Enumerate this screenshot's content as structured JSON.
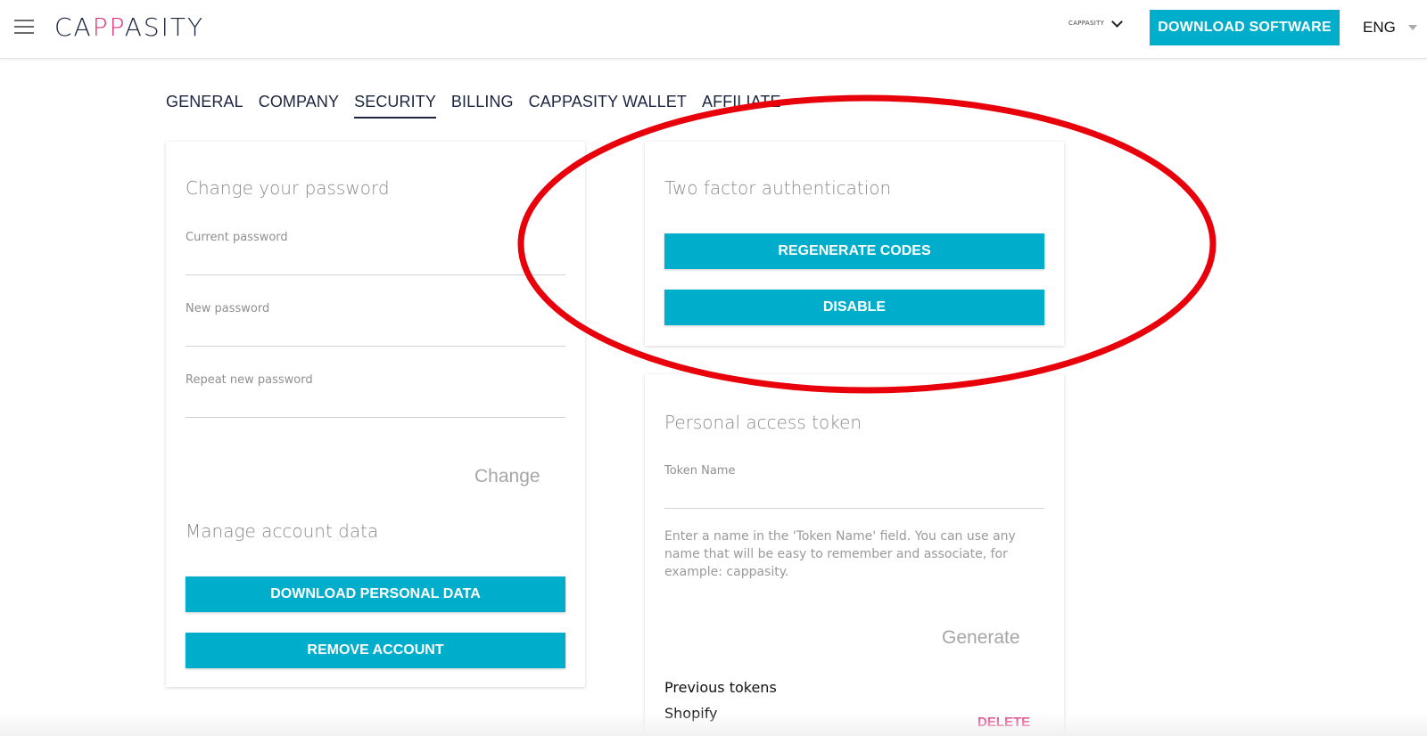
{
  "header": {
    "logo_prefix": "CA",
    "logo_pp": "PP",
    "logo_suffix": "ASITY",
    "account_name": "CAPPASITY",
    "download_software_label": "DOWNLOAD SOFTWARE",
    "language": "ENG"
  },
  "tabs": [
    {
      "label": "GENERAL",
      "active": false
    },
    {
      "label": "COMPANY",
      "active": false
    },
    {
      "label": "SECURITY",
      "active": true
    },
    {
      "label": "BILLING",
      "active": false
    },
    {
      "label": "CAPPASITY WALLET",
      "active": false
    },
    {
      "label": "AFFILIATE",
      "active": false
    }
  ],
  "password_card": {
    "title": "Change your password",
    "current_label": "Current password",
    "new_label": "New password",
    "repeat_label": "Repeat new password",
    "change_label": "Change"
  },
  "account_data": {
    "title": "Manage account data",
    "download_label": "DOWNLOAD PERSONAL DATA",
    "remove_label": "REMOVE ACCOUNT"
  },
  "twofa_card": {
    "title": "Two factor authentication",
    "regenerate_label": "REGENERATE CODES",
    "disable_label": "DISABLE"
  },
  "token_card": {
    "title": "Personal access token",
    "token_name_label": "Token Name",
    "help": "Enter a name in the 'Token Name' field. You can use any name that will be easy to remember and associate, for example: cappasity.",
    "generate_label": "Generate",
    "previous_title": "Previous tokens",
    "tokens": [
      {
        "name": "Shopify",
        "delete_label": "DELETE"
      }
    ]
  },
  "colors": {
    "accent": "#00aecb",
    "brand_pink": "#e0317a",
    "navy": "#1b2540",
    "highlight_ring": "#e8000b"
  }
}
